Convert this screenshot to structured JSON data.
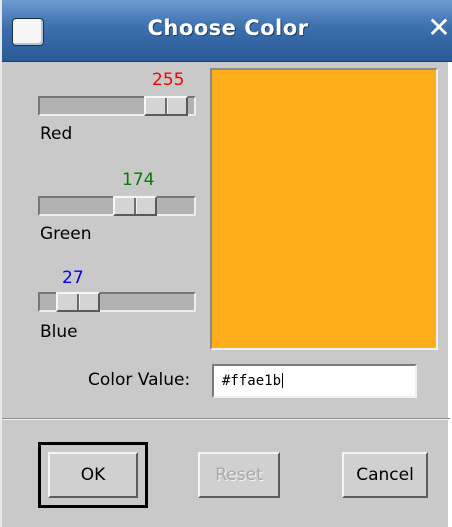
{
  "window": {
    "title": "Choose Color",
    "close_glyph": "✕"
  },
  "sliders": [
    {
      "name": "Red",
      "value": "255",
      "value_color": "#ff0000",
      "level": 1.0
    },
    {
      "name": "Green",
      "value": "174",
      "value_color": "#008000",
      "level": 0.682
    },
    {
      "name": "Blue",
      "value": "27",
      "value_color": "#0000ff",
      "level": 0.106
    }
  ],
  "preview": {
    "color": "#ffae1b"
  },
  "color_value": {
    "label": "Color Value:",
    "value": "#ffae1b"
  },
  "buttons": {
    "ok": "OK",
    "reset": "Reset",
    "cancel": "Cancel"
  },
  "icons": {
    "window_menu": "window-menu-icon",
    "close": "close-icon"
  }
}
